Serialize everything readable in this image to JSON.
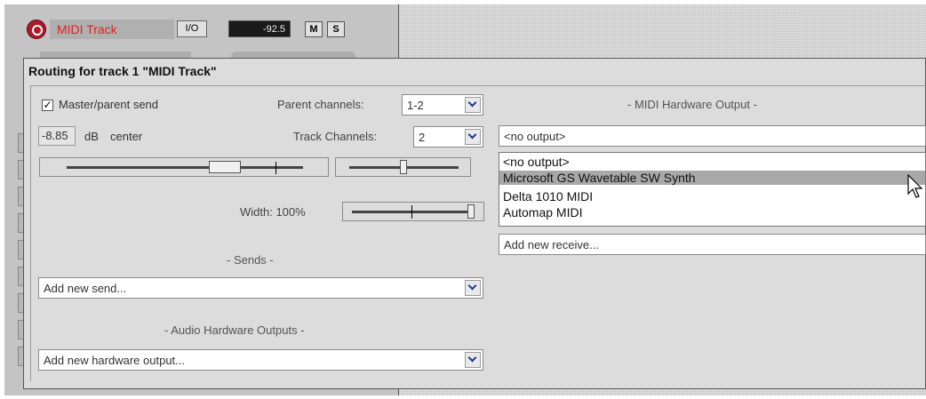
{
  "track": {
    "name": "MIDI Track",
    "io_label": "I/O",
    "volume_value": "-92.5",
    "mute_label": "M",
    "solo_label": "S"
  },
  "dialog": {
    "title": "Routing for track 1 \"MIDI Track\"",
    "master_send_label": "Master/parent send",
    "master_send_checked": true,
    "parent_channels_label": "Parent channels:",
    "parent_channels_value": "1-2",
    "volume_value": "-8.85",
    "db_label": "dB",
    "pan_label": "center",
    "track_channels_label": "Track Channels:",
    "track_channels_value": "2",
    "width_label": "Width: 100%",
    "sends_header": "- Sends -",
    "add_send_placeholder": "Add new send...",
    "audio_hw_header": "- Audio Hardware Outputs -",
    "add_hw_output_placeholder": "Add new hardware output...",
    "midi_hw_header": "- MIDI Hardware Output -",
    "midi_output_selected": "<no output>",
    "midi_output_options": [
      "<no output>",
      "Microsoft GS Wavetable SW Synth",
      "Delta 1010 MIDI",
      "Automap MIDI"
    ],
    "midi_output_highlighted": "Microsoft GS Wavetable SW Synth",
    "add_receive_placeholder": "Add new receive..."
  },
  "colors": {
    "record_arm": "#b0192a",
    "track_name_text": "#e02020",
    "list_highlight": "#a8a8a8"
  },
  "icons": {
    "record_arm": "record-arm-icon",
    "dropdown": "chevron-down-icon",
    "cursor": "mouse-pointer-icon"
  }
}
